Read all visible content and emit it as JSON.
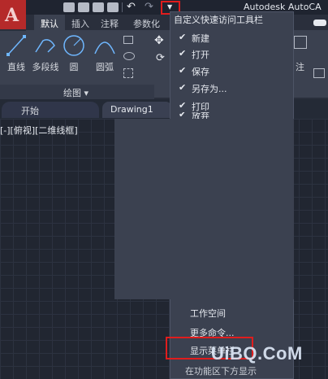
{
  "window": {
    "title": "Autodesk AutoCA"
  },
  "ribbon": {
    "tabs": [
      "默认",
      "插入",
      "注释",
      "参数化"
    ],
    "tools": {
      "line": "直线",
      "polyline": "多段线",
      "circle": "圆",
      "arc": "圆弧"
    },
    "draw_panel_label": "绘图 ▾",
    "right_block_label": "注"
  },
  "doc_tabs": {
    "start": "开始",
    "drawing": "Drawing1"
  },
  "viewport": {
    "label": "[-][俯视][二维线框]"
  },
  "qat_menu": {
    "title": "自定义快速访问工具栏",
    "items": [
      {
        "label": "新建",
        "checked": true
      },
      {
        "label": "打开",
        "checked": true
      },
      {
        "label": "保存",
        "checked": true
      },
      {
        "label": "另存为...",
        "checked": true
      },
      {
        "label": "打印",
        "checked": true
      },
      {
        "label": "放弃",
        "checked": true
      }
    ],
    "bottom_items": {
      "workspace": "工作空间",
      "more_commands": "更多命令...",
      "show_menubar": "显示菜单栏",
      "below_ribbon": "在功能区下方显示"
    }
  },
  "watermark": "UiBQ.CoM",
  "colors": {
    "highlight": "#e01d1d",
    "logo": "#b52a2a",
    "menu_bg": "#3b4150"
  },
  "icons": {
    "dropdown": "chevron-down-icon",
    "check": "checkmark-icon"
  }
}
